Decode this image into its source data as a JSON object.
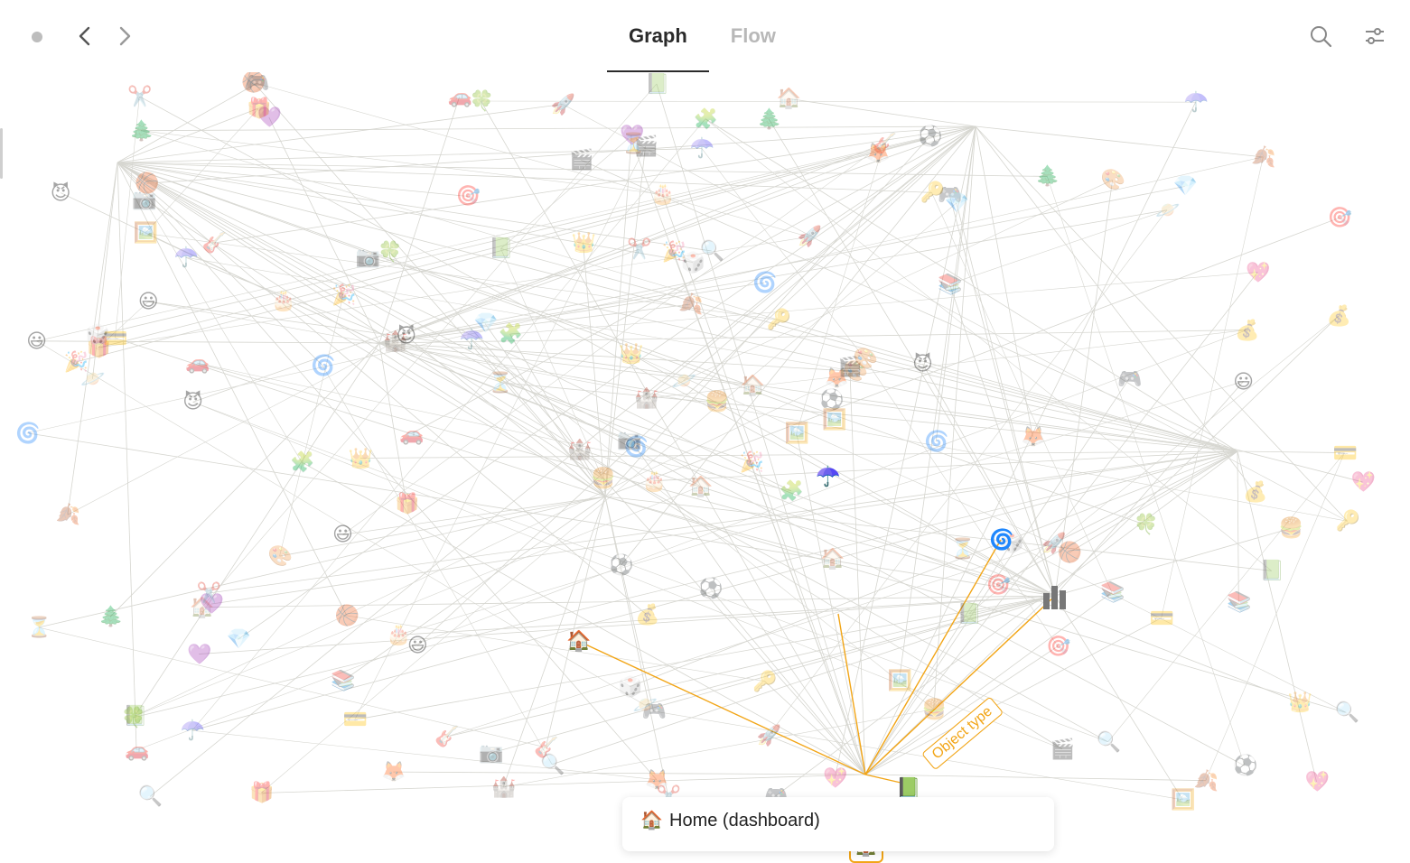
{
  "tabs": [
    {
      "label": "Graph",
      "active": true
    },
    {
      "label": "Flow",
      "active": false
    }
  ],
  "colors": {
    "accent": "#f2a516",
    "edge": "#d6d6d0",
    "tab_active": "#2a2a2a",
    "tab_inactive": "#b8b8b8"
  },
  "icons": {
    "back": "chevron-left-icon",
    "forward": "chevron-right-icon",
    "search": "search-icon",
    "settings": "sliders-icon",
    "status": "status-dot-icon"
  },
  "selected": {
    "emoji": "🏠",
    "edge_label": "Object type"
  },
  "tooltip": {
    "emoji": "🏠",
    "title": "Home (dashboard)"
  },
  "nodes": [
    {
      "emoji": "🏠"
    },
    {
      "emoji": "☂️"
    },
    {
      "emoji": "🌀"
    },
    {
      "emoji": "📗"
    },
    {
      "emoji": "🦊"
    },
    {
      "emoji": "😃"
    },
    {
      "emoji": "⚽"
    },
    {
      "emoji": "🔍"
    },
    {
      "emoji": "🎮"
    },
    {
      "emoji": "🖼️"
    },
    {
      "emoji": "💜"
    },
    {
      "emoji": "💖"
    },
    {
      "emoji": "😈"
    },
    {
      "emoji": "🎯"
    },
    {
      "emoji": "🍔"
    },
    {
      "emoji": "📚"
    },
    {
      "emoji": "🎁"
    },
    {
      "emoji": "✂️"
    },
    {
      "emoji": "🔑"
    },
    {
      "emoji": "💎"
    },
    {
      "emoji": "🧩"
    },
    {
      "emoji": "🚗"
    },
    {
      "emoji": "💳"
    },
    {
      "emoji": "🎉"
    },
    {
      "emoji": "🎨"
    },
    {
      "emoji": "🏀"
    },
    {
      "emoji": "🎸"
    },
    {
      "emoji": "🎬"
    },
    {
      "emoji": "🪐"
    },
    {
      "emoji": "⏳"
    },
    {
      "emoji": "💰"
    },
    {
      "emoji": "📷"
    },
    {
      "emoji": "🎲"
    },
    {
      "emoji": "🏰"
    },
    {
      "emoji": "🍀"
    },
    {
      "emoji": "🌲"
    },
    {
      "emoji": "🎂"
    },
    {
      "emoji": "🍂"
    },
    {
      "emoji": "👑"
    },
    {
      "emoji": "🚀"
    }
  ]
}
